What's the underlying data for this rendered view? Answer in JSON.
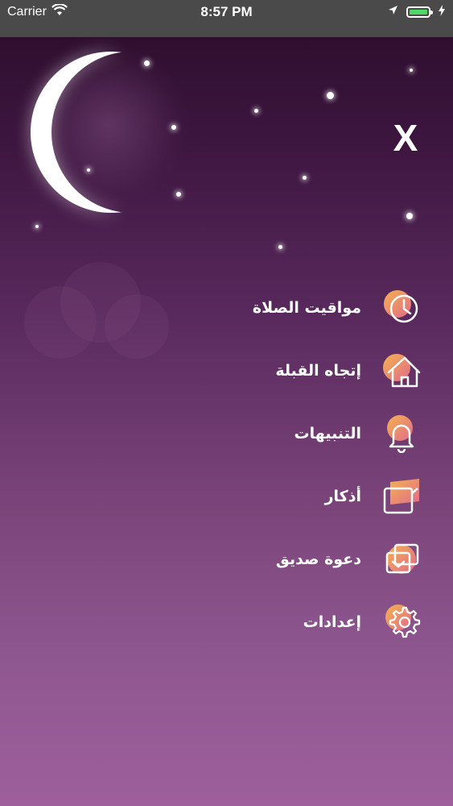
{
  "status_bar": {
    "carrier": "Carrier",
    "time": "8:57 PM"
  },
  "header": {
    "close_label": "X"
  },
  "menu": {
    "items": [
      {
        "label": "مواقيت الصلاة",
        "icon": "clock-icon"
      },
      {
        "label": "إتجاه القبلة",
        "icon": "house-icon"
      },
      {
        "label": "التنبيهات",
        "icon": "bell-icon"
      },
      {
        "label": "أذكار",
        "icon": "book-icon"
      },
      {
        "label": "دعوة صديق",
        "icon": "share-icon"
      },
      {
        "label": "إعدادات",
        "icon": "gear-icon"
      }
    ]
  },
  "colors": {
    "accent_orange": "#f2a54a",
    "accent_pink": "#e06a8c",
    "battery_green": "#4cd964"
  }
}
